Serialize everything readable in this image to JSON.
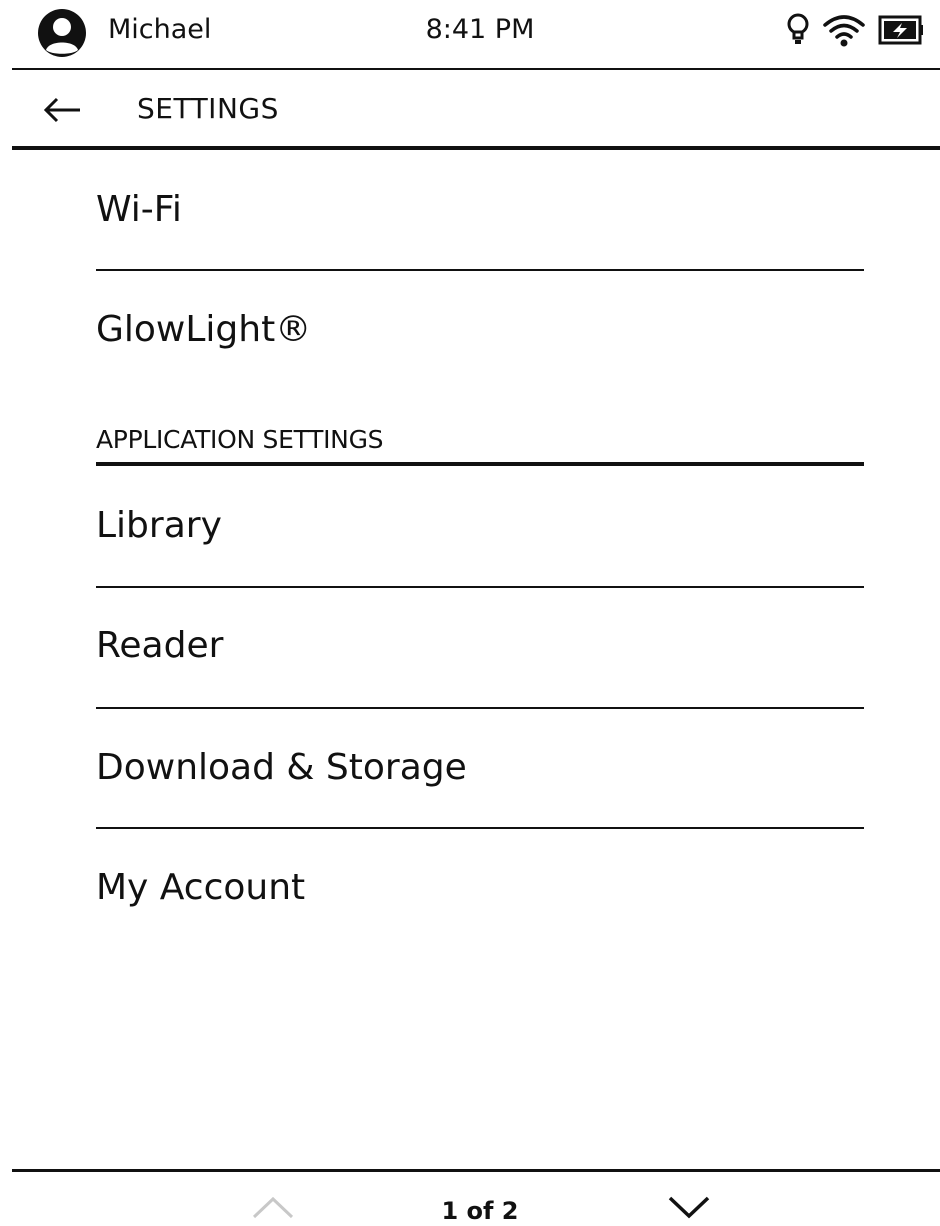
{
  "status_bar": {
    "user_name": "Michael",
    "time": "8:41 PM",
    "icons": [
      "avatar-icon",
      "glowlight-bulb-icon",
      "wifi-icon",
      "battery-charging-icon"
    ]
  },
  "header": {
    "back_icon": "arrow-left-icon",
    "title": "SETTINGS"
  },
  "settings": {
    "device_items": [
      {
        "label": "Wi-Fi"
      },
      {
        "label": "GlowLight®"
      }
    ],
    "application_section": {
      "title": "APPLICATION SETTINGS",
      "items": [
        {
          "label": "Library"
        },
        {
          "label": "Reader"
        },
        {
          "label": "Download & Storage"
        },
        {
          "label": "My Account"
        }
      ]
    }
  },
  "pager": {
    "status": "1 of 2",
    "prev_icon": "chevron-up-icon",
    "next_icon": "chevron-down-icon",
    "prev_enabled": false,
    "next_enabled": true
  },
  "colors": {
    "foreground": "#111111",
    "background": "#ffffff",
    "disabled": "#c8c8c8"
  }
}
